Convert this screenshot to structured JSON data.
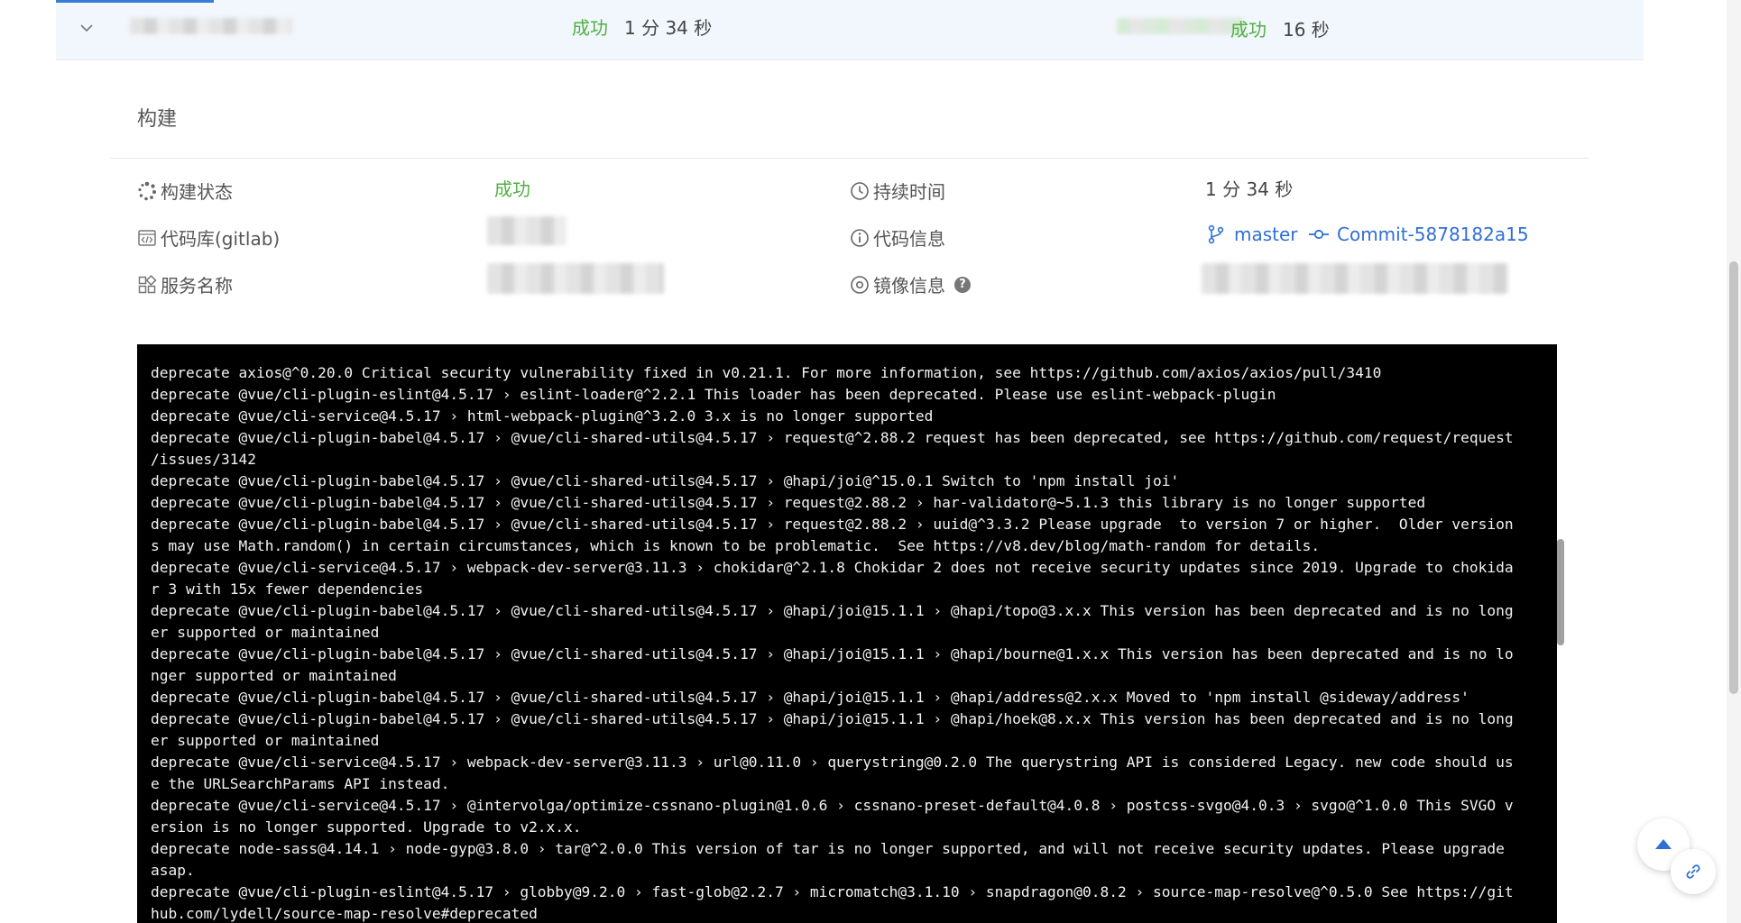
{
  "pipeline_row": {
    "status": "成功",
    "duration": "1 分 34 秒",
    "stage2_status": "成功",
    "stage2_duration": "16 秒"
  },
  "build": {
    "section_title": "构建",
    "fields": {
      "status_label": "构建状态",
      "status_value": "成功",
      "duration_label": "持续时间",
      "duration_value": "1 分 34 秒",
      "repo_label": "代码库(gitlab)",
      "code_info_label": "代码信息",
      "branch": "master",
      "commit": "Commit-5878182a15",
      "service_label": "服务名称",
      "image_label": "镜像信息",
      "help_glyph": "?"
    }
  },
  "console": {
    "lines": [
      "deprecate axios@^0.20.0 Critical security vulnerability fixed in v0.21.1. For more information, see https://github.com/axios/axios/pull/3410",
      "deprecate @vue/cli-plugin-eslint@4.5.17 › eslint-loader@^2.2.1 This loader has been deprecated. Please use eslint-webpack-plugin",
      "deprecate @vue/cli-service@4.5.17 › html-webpack-plugin@^3.2.0 3.x is no longer supported",
      "deprecate @vue/cli-plugin-babel@4.5.17 › @vue/cli-shared-utils@4.5.17 › request@^2.88.2 request has been deprecated, see https://github.com/request/request",
      "/issues/3142",
      "deprecate @vue/cli-plugin-babel@4.5.17 › @vue/cli-shared-utils@4.5.17 › @hapi/joi@^15.0.1 Switch to 'npm install joi'",
      "deprecate @vue/cli-plugin-babel@4.5.17 › @vue/cli-shared-utils@4.5.17 › request@2.88.2 › har-validator@~5.1.3 this library is no longer supported",
      "deprecate @vue/cli-plugin-babel@4.5.17 › @vue/cli-shared-utils@4.5.17 › request@2.88.2 › uuid@^3.3.2 Please upgrade  to version 7 or higher.  Older version",
      "s may use Math.random() in certain circumstances, which is known to be problematic.  See https://v8.dev/blog/math-random for details.",
      "deprecate @vue/cli-service@4.5.17 › webpack-dev-server@3.11.3 › chokidar@^2.1.8 Chokidar 2 does not receive security updates since 2019. Upgrade to chokida",
      "r 3 with 15x fewer dependencies",
      "deprecate @vue/cli-plugin-babel@4.5.17 › @vue/cli-shared-utils@4.5.17 › @hapi/joi@15.1.1 › @hapi/topo@3.x.x This version has been deprecated and is no long",
      "er supported or maintained",
      "deprecate @vue/cli-plugin-babel@4.5.17 › @vue/cli-shared-utils@4.5.17 › @hapi/joi@15.1.1 › @hapi/bourne@1.x.x This version has been deprecated and is no lo",
      "nger supported or maintained",
      "deprecate @vue/cli-plugin-babel@4.5.17 › @vue/cli-shared-utils@4.5.17 › @hapi/joi@15.1.1 › @hapi/address@2.x.x Moved to 'npm install @sideway/address'",
      "deprecate @vue/cli-plugin-babel@4.5.17 › @vue/cli-shared-utils@4.5.17 › @hapi/joi@15.1.1 › @hapi/hoek@8.x.x This version has been deprecated and is no long",
      "er supported or maintained",
      "deprecate @vue/cli-service@4.5.17 › webpack-dev-server@3.11.3 › url@0.11.0 › querystring@0.2.0 The querystring API is considered Legacy. new code should us",
      "e the URLSearchParams API instead.",
      "deprecate @vue/cli-service@4.5.17 › @intervolga/optimize-cssnano-plugin@1.0.6 › cssnano-preset-default@4.0.8 › postcss-svgo@4.0.3 › svgo@^1.0.0 This SVGO v",
      "ersion is no longer supported. Upgrade to v2.x.x.",
      "deprecate node-sass@4.14.1 › node-gyp@3.8.0 › tar@^2.0.0 This version of tar is no longer supported, and will not receive security updates. Please upgrade",
      "asap.",
      "deprecate @vue/cli-plugin-eslint@4.5.17 › globby@9.2.0 › fast-glob@2.2.7 › micromatch@3.1.10 › snapdragon@0.8.2 › source-map-resolve@^0.5.0 See https://git",
      "hub.com/lydell/source-map-resolve#deprecated"
    ]
  }
}
